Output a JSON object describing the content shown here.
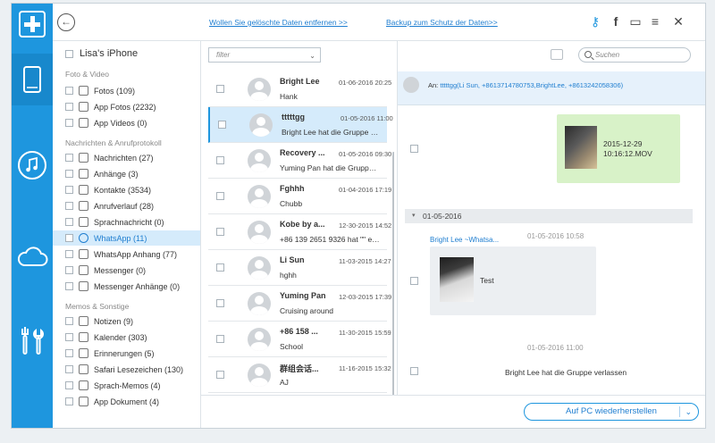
{
  "topbar": {
    "link_delete": "Wollen Sie gelöschte Daten entfernen >>",
    "link_backup": "Backup zum Schutz der Daten>>",
    "icons": [
      "key-icon",
      "facebook-icon",
      "chat-icon",
      "menu-icon",
      "close-icon"
    ],
    "icon_glyphs": {
      "key": "⚷",
      "facebook": "f",
      "chat": "▭",
      "menu": "≡",
      "close": "✕"
    }
  },
  "sidebar": {
    "device": "Lisa's iPhone",
    "sections": [
      {
        "title": "Foto & Video",
        "items": [
          "Fotos (109)",
          "App Fotos (2232)",
          "App Videos (0)"
        ]
      },
      {
        "title": "Nachrichten & Anrufprotokoll",
        "items": [
          "Nachrichten (27)",
          "Anhänge (3)",
          "Kontakte (3534)",
          "Anrufverlauf (28)",
          "Sprachnachricht (0)",
          "WhatsApp (11)",
          "WhatsApp Anhang (77)",
          "Messenger (0)",
          "Messenger Anhänge (0)"
        ]
      },
      {
        "title": "Memos & Sonstige",
        "items": [
          "Notizen (9)",
          "Kalender (303)",
          "Erinnerungen (5)",
          "Safari Lesezeichen (130)",
          "Sprach-Memos (4)",
          "App Dokument (4)"
        ]
      }
    ],
    "active_item": "WhatsApp (11)"
  },
  "list": {
    "filter_placeholder": "filter",
    "filter_caret": "⌄",
    "conversations": [
      {
        "name": "Bright Lee",
        "date": "01-06-2016 20:25",
        "preview": "Hank"
      },
      {
        "name": "tttttgg",
        "date": "01-05-2016 11:00",
        "preview": "Bright Lee hat die Gruppe verl..."
      },
      {
        "name": "Recovery ...",
        "date": "01-05-2016 09:30",
        "preview": "Yuming Pan hat die Gruppe verl..."
      },
      {
        "name": "Fghhh",
        "date": "01-04-2016 17:19",
        "preview": "Chubb"
      },
      {
        "name": "Kobe by a...",
        "date": "12-30-2015 14:52",
        "preview": "+86 139 2651 9326 hat \"\" ers..."
      },
      {
        "name": "Li Sun",
        "date": "11-03-2015 14:27",
        "preview": "hghh"
      },
      {
        "name": "Yuming Pan",
        "date": "12-03-2015 17:39",
        "preview": "Cruising around"
      },
      {
        "name": "+86 158 ...",
        "date": "11-30-2015 15:59",
        "preview": "School"
      },
      {
        "name": "群组会话...",
        "date": "11-16-2015 15:32",
        "preview": "AJ"
      }
    ],
    "selected_index": 1
  },
  "detail": {
    "search_placeholder": "Suchen",
    "to_label": "An:",
    "to_value": "tttttgg(Li Sun, +8613714780753,BrightLee, +8613242058306)",
    "outgoing_media_caption": [
      "2015-12-29",
      "10:16:12.MOV"
    ],
    "date_separator": "01-05-2016",
    "date_caret": "▾",
    "incoming_sender": "Bright Lee ~Whatsa...",
    "incoming_time": "01-05-2016 10:58",
    "incoming_media_caption": "Test",
    "system_time": "01-05-2016 11:00",
    "system_message": "Bright Lee hat die Gruppe verlassen"
  },
  "bottom": {
    "restore_label": "Auf PC wiederherstellen",
    "restore_caret": "⌄"
  },
  "colors": {
    "brand": "#1e96de",
    "active_bg": "#d5ebfb",
    "outgoing_bubble": "#d8f2c8",
    "link": "#1f7ed0"
  }
}
